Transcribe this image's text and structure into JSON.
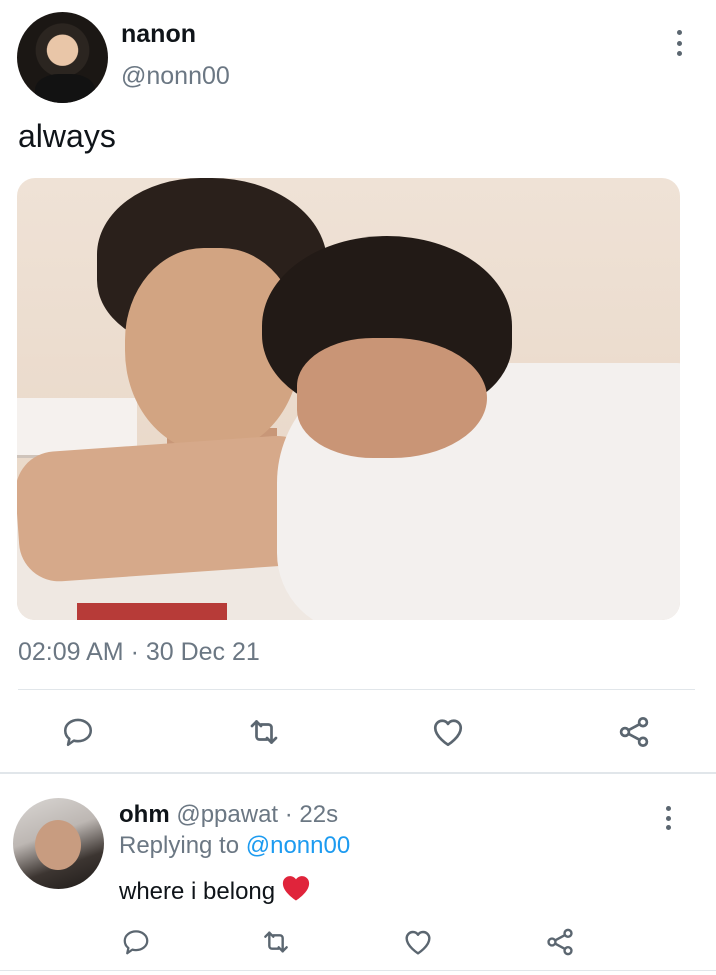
{
  "tweet": {
    "display_name": "nanon",
    "handle": "@nonn00",
    "text": "always",
    "timestamp": "02:09 AM · 30 Dec 21",
    "actions": [
      "reply-icon",
      "retweet-icon",
      "like-icon",
      "share-icon"
    ]
  },
  "reply": {
    "display_name": "ohm",
    "meta": "@ppawat · 22s",
    "replying_prefix": "Replying to ",
    "replying_to": "@nonn00",
    "text": "where i belong",
    "emoji": "red-heart-emoji",
    "actions": [
      "reply-icon",
      "retweet-icon",
      "like-icon",
      "share-icon"
    ]
  },
  "colors": {
    "text": "#0f1419",
    "secondary": "#6b7783",
    "link": "#1d9bf0",
    "divider": "#e1e6ea",
    "heart": "#e0245e"
  }
}
